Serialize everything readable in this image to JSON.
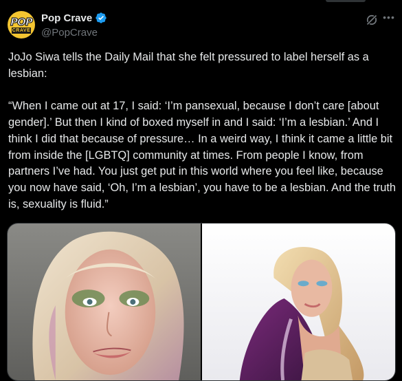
{
  "author": {
    "display_name": "Pop Crave",
    "handle": "@PopCrave",
    "verified": true,
    "avatar_text_top": "POP",
    "avatar_text_bottom": "CRAVE"
  },
  "actions": {
    "grok_icon": "grok-icon",
    "more_icon": "more-icon"
  },
  "tweet": {
    "paragraphs": [
      "JoJo Siwa tells the Daily Mail that she felt pressured to label herself as a lesbian:",
      "“When I came out at 17, I said: ‘I’m pansexual, because I don’t care [about gender].’ But then I kind of boxed myself in and I said: ‘I’m a lesbian.’ And I think I did that because of pressure… In a weird way, I think it came a little bit from inside the [LGBTQ] community at times. From people I know, from partners I’ve had. You just get put in this world where you feel like, because you now have said, ‘Oh, I’m a lesbian’, you have to be a lesbian. And the truth is, sexuality is fluid.”"
    ]
  },
  "media": {
    "count": 2
  },
  "colors": {
    "background": "#000000",
    "text": "#e7e9ea",
    "secondary": "#71767b",
    "verified": "#1d9bf0",
    "avatar_bg": "#f4c531"
  }
}
